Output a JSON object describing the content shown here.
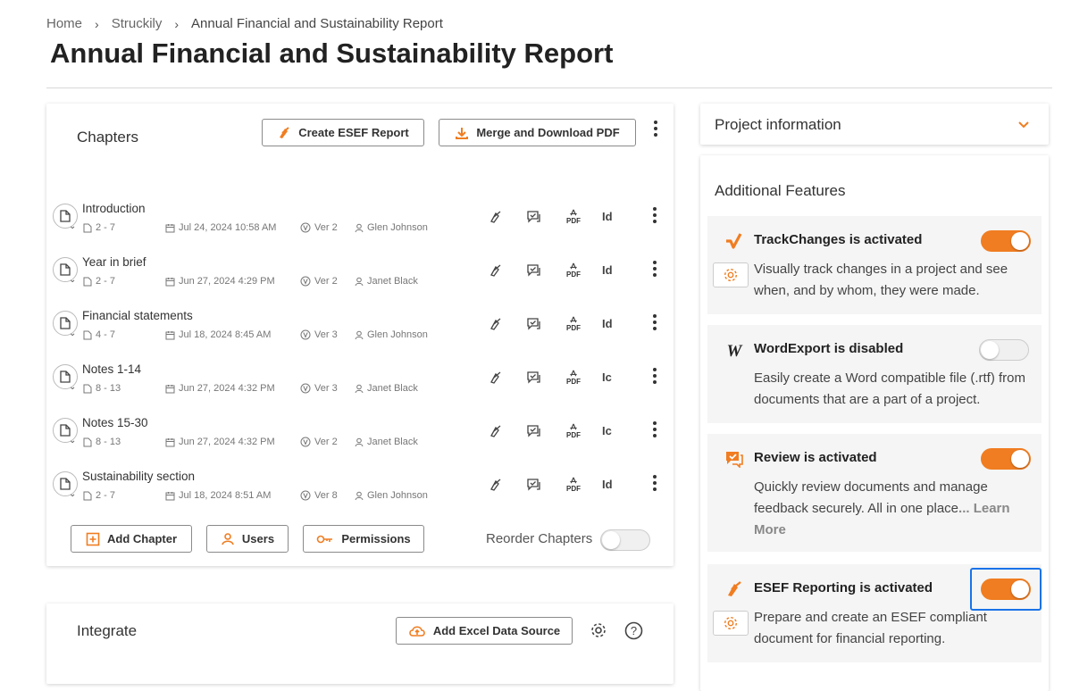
{
  "breadcrumb": {
    "home": "Home",
    "parent": "Struckily",
    "current": "Annual Financial and Sustainability Report"
  },
  "page_title": "Annual Financial and Sustainability Report",
  "chapters": {
    "title": "Chapters",
    "create_esef_label": "Create ESEF Report",
    "merge_pdf_label": "Merge and Download PDF",
    "rows": [
      {
        "name": "Introduction",
        "pages": "2 - 7",
        "date": "Jul 24, 2024 10:58 AM",
        "version": "Ver 2",
        "user": "Glen Johnson",
        "id": "Id"
      },
      {
        "name": "Year in brief",
        "pages": "2 - 7",
        "date": "Jun 27, 2024 4:29 PM",
        "version": "Ver 2",
        "user": "Janet Black",
        "id": "Id"
      },
      {
        "name": "Financial statements",
        "pages": "4 - 7",
        "date": "Jul 18, 2024 8:45 AM",
        "version": "Ver 3",
        "user": "Glen Johnson",
        "id": "Id"
      },
      {
        "name": "Notes 1-14",
        "pages": "8 - 13",
        "date": "Jun 27, 2024 4:32 PM",
        "version": "Ver 3",
        "user": "Janet Black",
        "id": "Ic"
      },
      {
        "name": "Notes 15-30",
        "pages": "8 - 13",
        "date": "Jun 27, 2024 4:32 PM",
        "version": "Ver 2",
        "user": "Janet Black",
        "id": "Ic"
      },
      {
        "name": "Sustainability section",
        "pages": "2 - 7",
        "date": "Jul 18, 2024 8:51 AM",
        "version": "Ver 8",
        "user": "Glen Johnson",
        "id": "Id"
      }
    ],
    "pdf_label": "PDF",
    "add_chapter_label": "Add Chapter",
    "users_label": "Users",
    "permissions_label": "Permissions",
    "reorder_label": "Reorder Chapters"
  },
  "integrate": {
    "title": "Integrate",
    "add_excel_label": "Add Excel Data Source"
  },
  "project_info": {
    "title": "Project information"
  },
  "features": {
    "title": "Additional Features",
    "items": [
      {
        "title": "TrackChanges is activated",
        "desc": "Visually track changes in a project and see when, and by whom, they were made.",
        "enabled": true
      },
      {
        "title": "WordExport is disabled",
        "desc": "Easily create a Word compatible file (.rtf) from documents that are a part of a project.",
        "enabled": false
      },
      {
        "title": "Review is activated",
        "desc": "Quickly review documents and manage feedback securely. All in one place",
        "more": "... Learn More",
        "enabled": true
      },
      {
        "title": "ESEF Reporting is activated",
        "desc": "Prepare and create an ESEF compliant document for financial reporting.",
        "enabled": true
      }
    ]
  },
  "colors": {
    "accent": "#f07d21",
    "focus": "#1a73e8"
  }
}
